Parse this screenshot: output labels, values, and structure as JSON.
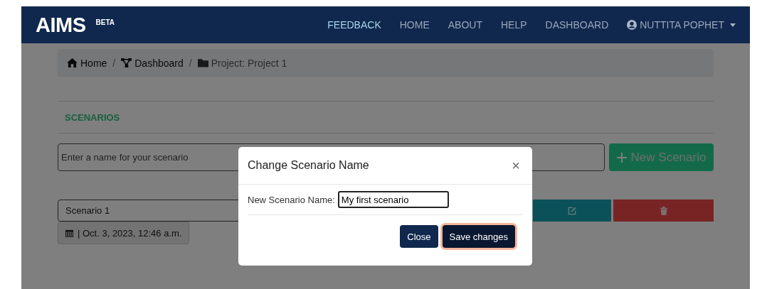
{
  "navbar": {
    "brand": "AIMS",
    "badge": "BETA",
    "items": [
      {
        "label": "FEEDBACK",
        "selected": true
      },
      {
        "label": "HOME",
        "selected": false
      },
      {
        "label": "ABOUT",
        "selected": false
      },
      {
        "label": "HELP",
        "selected": false
      },
      {
        "label": "DASHBOARD",
        "selected": false
      }
    ],
    "user": "NUTTITA POPHET"
  },
  "breadcrumb_separator": "/",
  "breadcrumb": [
    {
      "kind": "home",
      "label": "Home"
    },
    {
      "kind": "dashboard",
      "label": "Dashboard"
    },
    {
      "kind": "folder",
      "label": "Project: Project 1"
    }
  ],
  "section_title": "SCENARIOS",
  "new_scenario": {
    "placeholder": "Enter a name for your scenario",
    "button": "New Scenario"
  },
  "scenarios": [
    {
      "name": "Scenario 1",
      "date": "| Oct. 3, 2023, 12:46 a.m."
    }
  ],
  "modal": {
    "title": "Change Scenario Name",
    "close": "×",
    "field_label": "New Scenario Name:",
    "field_value": "My first scenario",
    "buttons": [
      {
        "kind": "close",
        "label": "Close",
        "focused": false
      },
      {
        "kind": "save",
        "label": "Save changes",
        "focused": true
      }
    ]
  }
}
